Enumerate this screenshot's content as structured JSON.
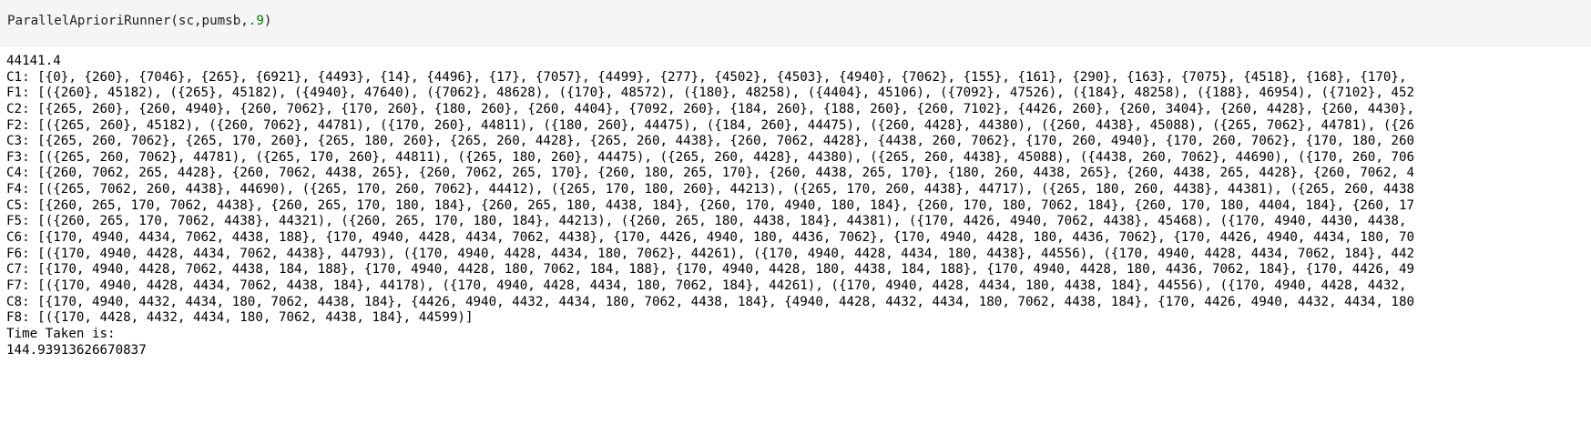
{
  "input": {
    "code_func": "ParallelAprioriRunner(sc,pumsb,",
    "code_arg": ".9",
    "code_close": ")"
  },
  "output": {
    "lines": [
      "44141.4",
      "C1: [{0}, {260}, {7046}, {265}, {6921}, {4493}, {14}, {4496}, {17}, {7057}, {4499}, {277}, {4502}, {4503}, {4940}, {7062}, {155}, {161}, {290}, {163}, {7075}, {4518}, {168}, {170},",
      "F1: [({260}, 45182), ({265}, 45182), ({4940}, 47640), ({7062}, 48628), ({170}, 48572), ({180}, 48258), ({4404}, 45106), ({7092}, 47526), ({184}, 48258), ({188}, 46954), ({7102}, 452",
      "C2: [{265, 260}, {260, 4940}, {260, 7062}, {170, 260}, {180, 260}, {260, 4404}, {7092, 260}, {184, 260}, {188, 260}, {260, 7102}, {4426, 260}, {260, 3404}, {260, 4428}, {260, 4430},",
      "F2: [({265, 260}, 45182), ({260, 7062}, 44781), ({170, 260}, 44811), ({180, 260}, 44475), ({184, 260}, 44475), ({260, 4428}, 44380), ({260, 4438}, 45088), ({265, 7062}, 44781), ({26",
      "C3: [{265, 260, 7062}, {265, 170, 260}, {265, 180, 260}, {265, 260, 4428}, {265, 260, 4438}, {260, 7062, 4428}, {4438, 260, 7062}, {170, 260, 4940}, {170, 260, 7062}, {170, 180, 260",
      "F3: [({265, 260, 7062}, 44781), ({265, 170, 260}, 44811), ({265, 180, 260}, 44475), ({265, 260, 4428}, 44380), ({265, 260, 4438}, 45088), ({4438, 260, 7062}, 44690), ({170, 260, 706",
      "C4: [{260, 7062, 265, 4428}, {260, 7062, 4438, 265}, {260, 7062, 265, 170}, {260, 180, 265, 170}, {260, 4438, 265, 170}, {180, 260, 4438, 265}, {260, 4438, 265, 4428}, {260, 7062, 4",
      "F4: [({265, 7062, 260, 4438}, 44690), ({265, 170, 260, 7062}, 44412), ({265, 170, 180, 260}, 44213), ({265, 170, 260, 4438}, 44717), ({265, 180, 260, 4438}, 44381), ({265, 260, 4438",
      "C5: [{260, 265, 170, 7062, 4438}, {260, 265, 170, 180, 184}, {260, 265, 180, 4438, 184}, {260, 170, 4940, 180, 184}, {260, 170, 180, 7062, 184}, {260, 170, 180, 4404, 184}, {260, 17",
      "F5: [({260, 265, 170, 7062, 4438}, 44321), ({260, 265, 170, 180, 184}, 44213), ({260, 265, 180, 4438, 184}, 44381), ({170, 4426, 4940, 7062, 4438}, 45468), ({170, 4940, 4430, 4438,",
      "C6: [{170, 4940, 4434, 7062, 4438, 188}, {170, 4940, 4428, 4434, 7062, 4438}, {170, 4426, 4940, 180, 4436, 7062}, {170, 4940, 4428, 180, 4436, 7062}, {170, 4426, 4940, 4434, 180, 70",
      "F6: [({170, 4940, 4428, 4434, 7062, 4438}, 44793), ({170, 4940, 4428, 4434, 180, 7062}, 44261), ({170, 4940, 4428, 4434, 180, 4438}, 44556), ({170, 4940, 4428, 4434, 7062, 184}, 442",
      "C7: [{170, 4940, 4428, 7062, 4438, 184, 188}, {170, 4940, 4428, 180, 7062, 184, 188}, {170, 4940, 4428, 180, 4438, 184, 188}, {170, 4940, 4428, 180, 4436, 7062, 184}, {170, 4426, 49",
      "F7: [({170, 4940, 4428, 4434, 7062, 4438, 184}, 44178), ({170, 4940, 4428, 4434, 180, 7062, 184}, 44261), ({170, 4940, 4428, 4434, 180, 4438, 184}, 44556), ({170, 4940, 4428, 4432,",
      "C8: [{170, 4940, 4432, 4434, 180, 7062, 4438, 184}, {4426, 4940, 4432, 4434, 180, 7062, 4438, 184}, {4940, 4428, 4432, 4434, 180, 7062, 4438, 184}, {170, 4426, 4940, 4432, 4434, 180",
      "F8: [({170, 4428, 4432, 4434, 180, 7062, 4438, 184}, 44599)]",
      "Time Taken is:",
      "144.93913626670837"
    ]
  }
}
